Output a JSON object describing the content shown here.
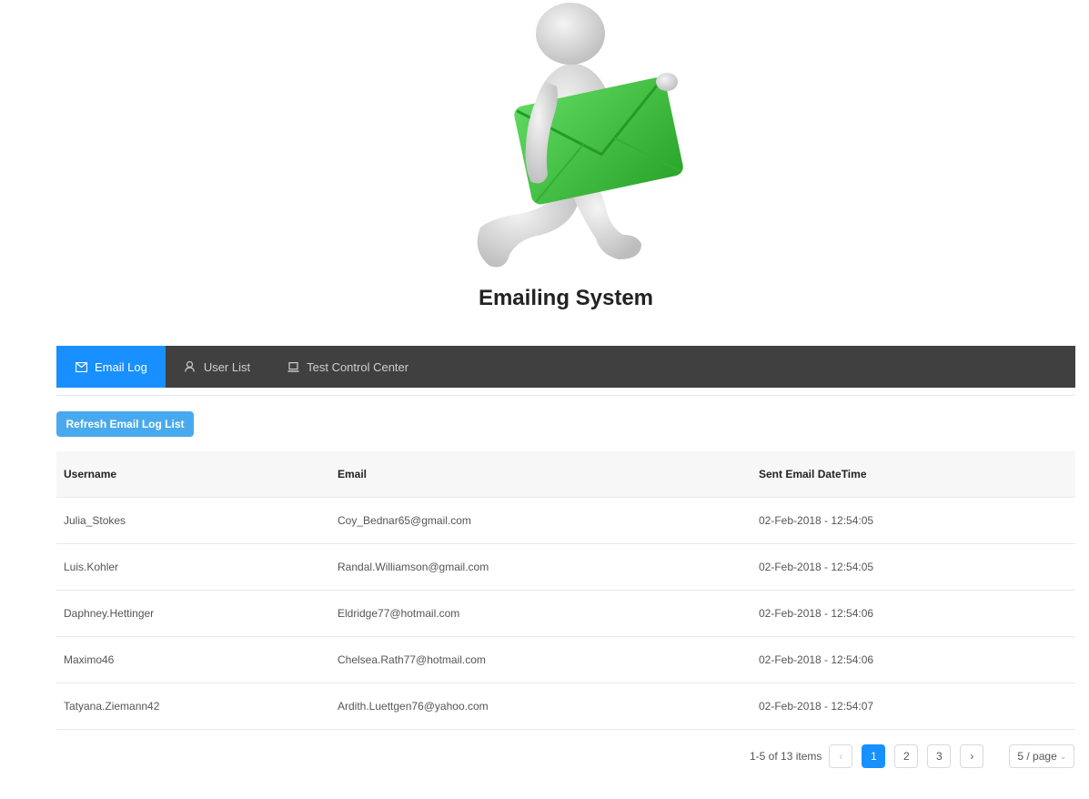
{
  "app": {
    "title": "Emailing System"
  },
  "nav": {
    "items": [
      {
        "label": "Email Log",
        "icon": "mail-icon",
        "active": true
      },
      {
        "label": "User List",
        "icon": "user-icon",
        "active": false
      },
      {
        "label": "Test Control Center",
        "icon": "laptop-icon",
        "active": false
      }
    ]
  },
  "toolbar": {
    "refresh_label": "Refresh Email Log List"
  },
  "table": {
    "columns": [
      "Username",
      "Email",
      "Sent Email DateTime"
    ],
    "rows": [
      [
        "Julia_Stokes",
        "Coy_Bednar65@gmail.com",
        "02-Feb-2018 - 12:54:05"
      ],
      [
        "Luis.Kohler",
        "Randal.Williamson@gmail.com",
        "02-Feb-2018 - 12:54:05"
      ],
      [
        "Daphney.Hettinger",
        "Eldridge77@hotmail.com",
        "02-Feb-2018 - 12:54:06"
      ],
      [
        "Maximo46",
        "Chelsea.Rath77@hotmail.com",
        "02-Feb-2018 - 12:54:06"
      ],
      [
        "Tatyana.Ziemann42",
        "Ardith.Luettgen76@yahoo.com",
        "02-Feb-2018 - 12:54:07"
      ]
    ]
  },
  "pagination": {
    "total_text": "1-5 of 13 items",
    "prev": "‹",
    "next": "›",
    "pages": [
      "1",
      "2",
      "3"
    ],
    "current_page": "1",
    "page_size": "5 / page"
  },
  "colors": {
    "accent": "#1890ff",
    "nav_bg": "#404040",
    "button": "#49a9ee",
    "envelope": "#3dbb3d"
  }
}
